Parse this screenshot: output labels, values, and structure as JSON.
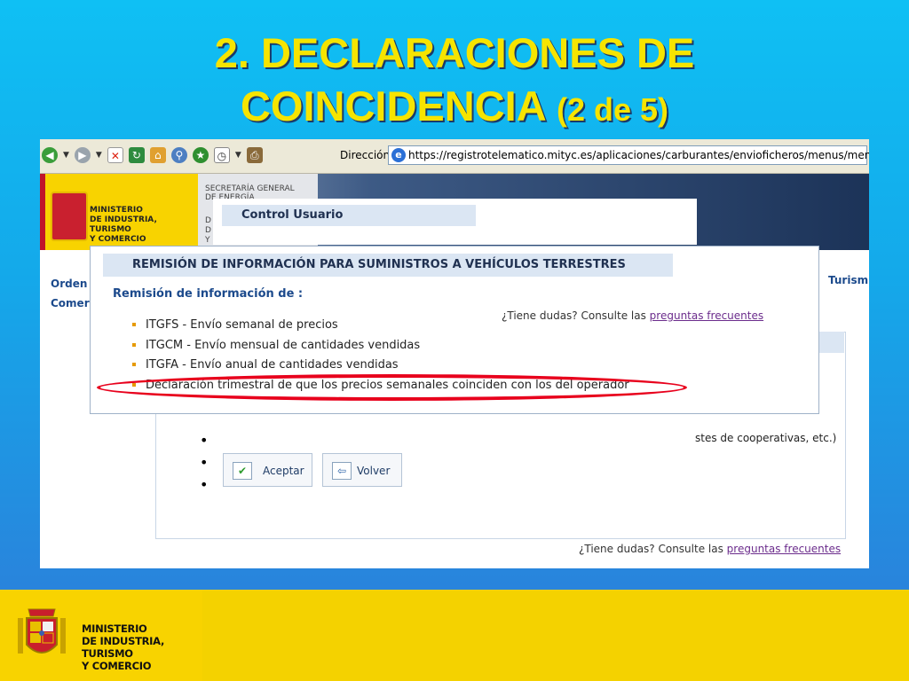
{
  "slide": {
    "title_line1": "2. DECLARACIONES DE",
    "title_line2": "COINCIDENCIA",
    "title_paren": "(2 de 5)"
  },
  "browser": {
    "address_label": "Dirección",
    "url": "https://registrotelematico.mityc.es/aplicaciones/carburantes/envioficheros/menus/menuprecios.aspx"
  },
  "site_header": {
    "ministry_line1": "MINISTERIO",
    "ministry_line2": "DE INDUSTRIA, TURISMO",
    "ministry_line3": "Y COMERCIO",
    "sec_line1": "SECRETARÍA GENERAL",
    "sec_line2": "DE ENERGÍA",
    "sec_d1": "D",
    "sec_d2": "D",
    "sec_d3": "Y"
  },
  "control_usuario": {
    "title": "Control Usuario"
  },
  "background_page": {
    "left_link1": "Orden",
    "left_link2": "Comer",
    "right_link": "Turism",
    "partial_text": "stes de cooperativas, etc.)",
    "accept_label": "Aceptar",
    "back_label": "Volver",
    "help_text": "¿Tiene dudas? Consulte las",
    "help_link": "preguntas frecuentes"
  },
  "dialog": {
    "title": "REMISIÓN DE INFORMACIÓN PARA SUMINISTROS A VEHÍCULOS TERRESTRES",
    "subtitle": "Remisión de información de :",
    "items": [
      "ITGFS - Envío semanal de precios",
      "ITGCM - Envío mensual de cantidades vendidas",
      "ITGFA - Envío anual de cantidades vendidas",
      "Declaración trimestral de que los precios semanales coinciden con los del operador"
    ],
    "help_text": "¿Tiene dudas? Consulte las",
    "help_link": "preguntas frecuentes"
  },
  "footer": {
    "line1": "MINISTERIO",
    "line2": "DE INDUSTRIA, TURISMO",
    "line3": "Y COMERCIO"
  },
  "colors": {
    "title_yellow": "#f6e400",
    "bg_top": "#0fc0f4",
    "bg_bottom": "#2f79d8",
    "highlight_red": "#e8001c",
    "footer_yellow": "#f4d200"
  },
  "icons": [
    "back-icon",
    "forward-icon",
    "stop-icon",
    "refresh-icon",
    "home-icon",
    "search-icon",
    "favorites-icon",
    "history-icon",
    "print-icon",
    "ie-icon",
    "checkmark-icon",
    "back-arrow-icon",
    "coat-of-arms-icon"
  ]
}
